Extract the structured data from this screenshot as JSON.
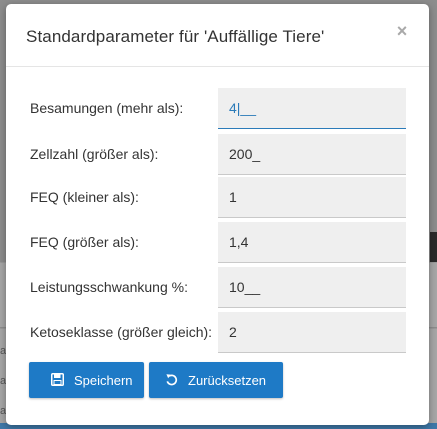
{
  "dialog": {
    "title": "Standardparameter für 'Auffällige Tiere'",
    "close_label": "×"
  },
  "fields": [
    {
      "label": "Besamungen (mehr als):",
      "value": "4|__",
      "focused": true
    },
    {
      "label": "Zellzahl (größer als):",
      "value": "200_"
    },
    {
      "label": "FEQ (kleiner als):",
      "value": "1"
    },
    {
      "label": "FEQ (größer als):",
      "value": "1,4"
    },
    {
      "label": "Leistungsschwankung %:",
      "value": "10__"
    },
    {
      "label": "Ketoseklasse (größer gleich):",
      "value": "2"
    }
  ],
  "buttons": {
    "save_label": "Speichern",
    "save_icon": "floppy-disk-icon",
    "reset_label": "Zurücksetzen",
    "reset_icon": "undo-icon"
  },
  "background": {
    "left_glyphs": [
      "a",
      "a",
      "a"
    ]
  },
  "colors": {
    "primary": "#1e7ac6",
    "focus": "#2b7bb9",
    "input_bg": "#efefef",
    "close": "#a9a9a9"
  }
}
